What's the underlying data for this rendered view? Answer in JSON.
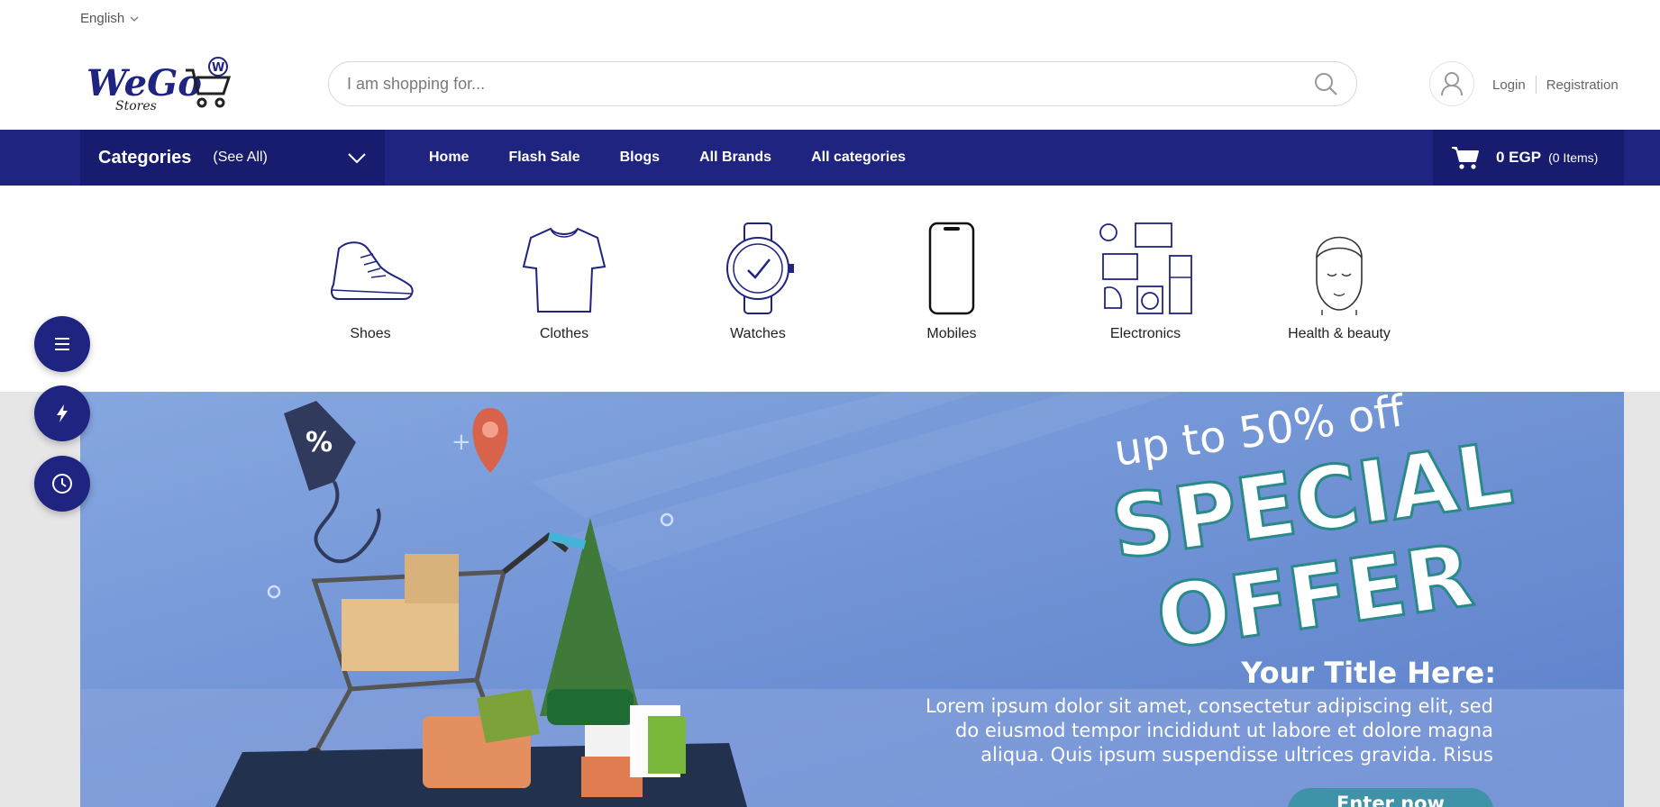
{
  "topbar": {
    "language": "English"
  },
  "header": {
    "logo_text": "WeGo",
    "logo_sub": "Stores",
    "logo_badge": "W",
    "search_placeholder": "I am shopping for...",
    "login": "Login",
    "registration": "Registration"
  },
  "nav": {
    "categories_title": "Categories",
    "see_all": "(See All)",
    "links": [
      "Home",
      "Flash Sale",
      "Blogs",
      "All Brands",
      "All categories"
    ],
    "cart_amount": "0 EGP",
    "cart_items": "(0 Items)"
  },
  "categories": [
    {
      "label": "Shoes",
      "icon": "shoe-icon"
    },
    {
      "label": "Clothes",
      "icon": "tshirt-icon"
    },
    {
      "label": "Watches",
      "icon": "watch-icon"
    },
    {
      "label": "Mobiles",
      "icon": "mobile-icon"
    },
    {
      "label": "Electronics",
      "icon": "electronics-icon"
    },
    {
      "label": "Health & beauty",
      "icon": "beauty-icon"
    }
  ],
  "banner": {
    "subtitle": "up to 50% off",
    "title_line1": "SPECIAL",
    "title_line2": "OFFER",
    "heading": "Your Title Here:",
    "body_line1": "Lorem ipsum dolor sit amet, consectetur adipiscing elit, sed",
    "body_line2": "do eiusmod tempor incididunt ut labore et dolore magna",
    "body_line3": "aliqua. Quis ipsum suspendisse ultrices gravida. Risus",
    "button": "Enter now",
    "tag_text": "%"
  },
  "floating": [
    {
      "icon": "menu-icon"
    },
    {
      "icon": "flash-icon"
    },
    {
      "icon": "clock-icon"
    }
  ],
  "colors": {
    "primary": "#1e2480",
    "primary_dark": "#171c6e",
    "banner_blue": "#6f95d6"
  }
}
